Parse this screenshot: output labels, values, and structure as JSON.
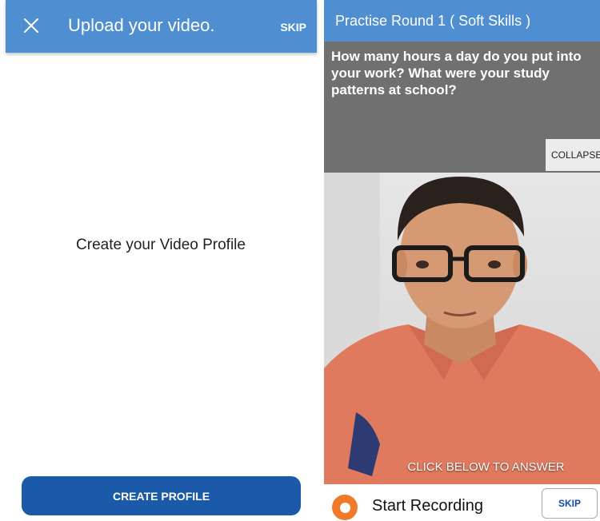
{
  "left_screen": {
    "header": {
      "title": "Upload your video.",
      "skip_label": "SKIP",
      "close_icon": "close-icon"
    },
    "heading": "Create your Video Profile",
    "create_button_label": "CREATE PROFILE"
  },
  "right_screen": {
    "header": {
      "title": "Practise Round 1 ( Soft Skills )"
    },
    "question": "How many hours a day do you put into your work? What were your study patterns at school?",
    "collapse_label": "COLLAPSE",
    "cta": "CLICK BELOW TO ANSWER",
    "recording": {
      "label": "Start Recording",
      "icon": "record-icon"
    },
    "skip_label": "SKIP"
  },
  "colors": {
    "header_blue": "#4f8fd1",
    "button_blue": "#1a5aa8",
    "record_orange": "#ee7a2a"
  }
}
